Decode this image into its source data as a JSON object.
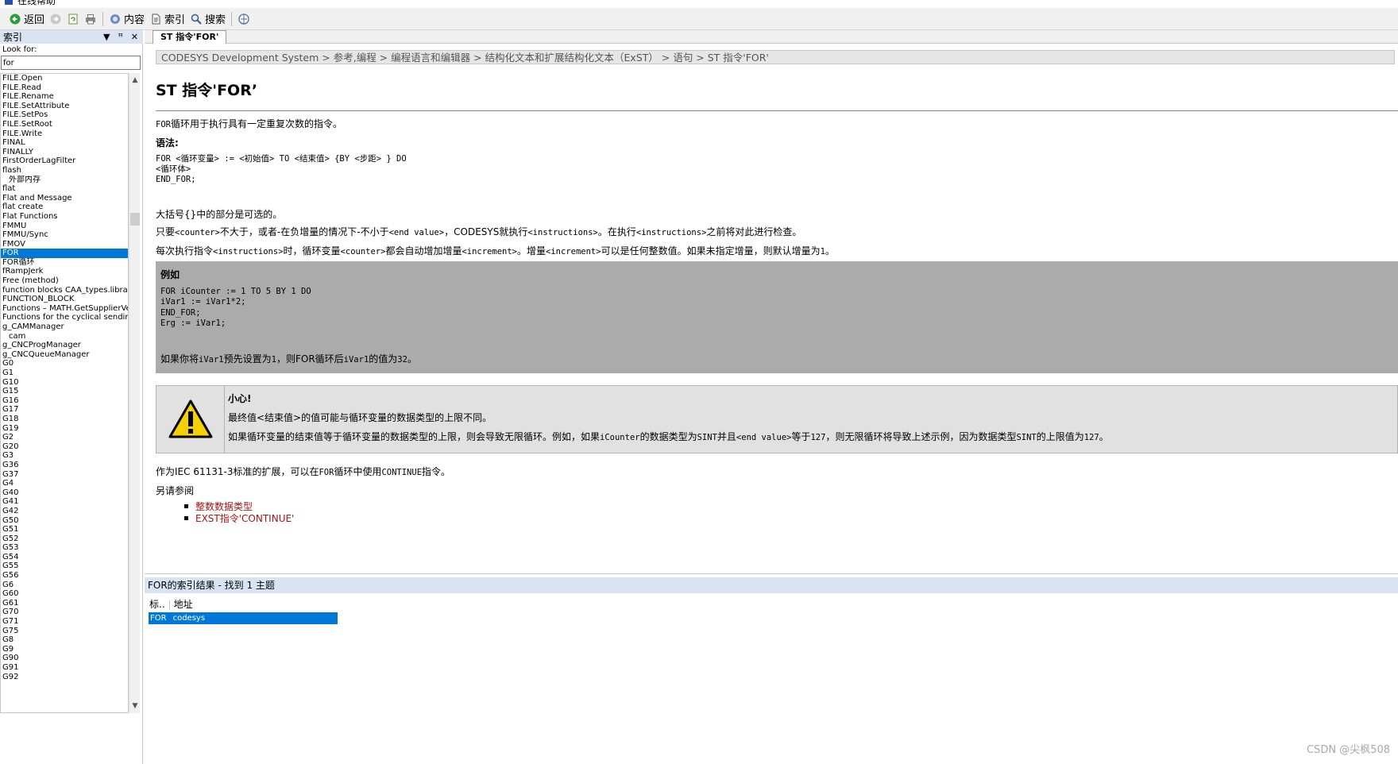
{
  "window": {
    "title": "在线帮助"
  },
  "toolbar": {
    "back_label": "返回",
    "contents_label": "内容",
    "index_label": "索引",
    "search_label": "搜索"
  },
  "left_pane": {
    "title": "索引",
    "look_for_label": "Look for:",
    "look_for_value": "for",
    "items": [
      "FILE.Open",
      "FILE.Read",
      "FILE.Rename",
      "FILE.SetAttribute",
      "FILE.SetPos",
      "FILE.SetRoot",
      "FILE.Write",
      "FINAL",
      "FINALLY",
      "FirstOrderLagFilter",
      "flash",
      "外部内存",
      "flat",
      "Flat and Message",
      "flat create",
      "Flat Functions",
      "FMMU",
      "FMMU/Sync",
      "FMOV",
      "FOR",
      "FOR循环",
      "fRampJerk",
      "Free (method)",
      "function blocks CAA_types.library",
      "FUNCTION_BLOCK",
      "Functions – MATH.GetSupplierVersion",
      "Functions for the cyclical sending of r",
      "g_CAMManager",
      "cam",
      "g_CNCProgManager",
      "g_CNCQueueManager",
      "G0",
      "G1",
      "G10",
      "G15",
      "G16",
      "G17",
      "G18",
      "G19",
      "G2",
      "G20",
      "G3",
      "G36",
      "G37",
      "G4",
      "G40",
      "G41",
      "G42",
      "G50",
      "G51",
      "G52",
      "G53",
      "G54",
      "G55",
      "G56",
      "G6",
      "G60",
      "G61",
      "G70",
      "G71",
      "G75",
      "G8",
      "G9",
      "G90",
      "G91",
      "G92"
    ],
    "indented_indices": [
      11,
      28
    ],
    "selected_index": 19
  },
  "tab": {
    "label": "ST 指令'FOR'"
  },
  "doc": {
    "breadcrumb": "CODESYS Development System > 参考,编程 > 编程语言和编辑器 > 结构化文本和扩展结构化文本（ExST） > 语句 > ST 指令'FOR'",
    "title": "ST 指令'FOR’",
    "intro_code": "FOR",
    "intro_text": "循环用于执行具有一定重复次数的指令。",
    "syntax_label": "语法:",
    "syntax_code": "FOR <循环变量> := <初始值> TO <结束值> {BY <步距> } DO\n<循环体>\nEND_FOR;",
    "brace_note": "大括号{}中的部分是可选的。",
    "para2": {
      "t1": "只要",
      "c1": "<counter>",
      "t2": "不大于，或者-在负增量的情况下-不小于",
      "c2": "<end value>",
      "t3": "，CODESYS就执行",
      "c3": "<instructions>",
      "t4": "。在执行",
      "c4": "<instructions>",
      "t5": "之前将对此进行检查。"
    },
    "para3": {
      "t1": "每次执行指令",
      "c1": "<instructions>",
      "t2": "时，循环变量",
      "c2": "<counter>",
      "t3": "都会自动增加增量",
      "c3": "<increment>",
      "t4": "。增量",
      "c4": "<increment>",
      "t5": "可以是任何整数值。如果未指定增量，则默认增量为",
      "c5": "1",
      "t6": "。"
    },
    "example": {
      "title": "例如",
      "code": "FOR iCounter := 1 TO 5 BY 1 DO\niVar1 := iVar1*2;\nEND_FOR;\nErg := iVar1;",
      "result": {
        "t1": "如果你将",
        "c1": "iVar1",
        "t2": "预先设置为",
        "c2": "1",
        "t3": "，则FOR循环后",
        "c3": "iVar1",
        "t4": "的值为",
        "c4": "32",
        "t5": "。"
      }
    },
    "caution": {
      "title": "小心!",
      "line1": "最终值<结束值>的值可能与循环变量的数据类型的上限不同。",
      "line2": {
        "t1": "如果循环变量的结束值等于循环变量的数据类型的上限，则会导致无限循环。例如，如果",
        "c1": "iCounter",
        "t2": "的数据类型为",
        "c2": "SINT",
        "t3": "并且",
        "c3": "<end value>",
        "t4": "等于",
        "c4": "127",
        "t5": "，则无限循环将导致上述示例，因为数据类型",
        "c5": "SINT",
        "t6": "的上限值为",
        "c6": "127",
        "t7": "。"
      }
    },
    "iec_note": {
      "t1": "作为IEC 61131-3标准的扩展，可以在",
      "c1": "FOR",
      "t2": "循环中使用",
      "c2": "CONTINUE",
      "t3": "指令。"
    },
    "see_also": "另请参阅",
    "links": [
      "整数数据类型",
      "EXST指令'CONTINUE'"
    ]
  },
  "results": {
    "header": "FOR的索引结果 - 找到 1 主题",
    "col_title": "标..",
    "col_address": "地址",
    "row_title": "FOR",
    "row_address": "codesys"
  },
  "watermark": "CSDN @尖枫508",
  "colors": {
    "selection": "#0078d7",
    "link": "#a31515",
    "pane_header": "#d9e3f2",
    "example_bg": "#ababab",
    "caution_bg": "#e1e1e1"
  }
}
